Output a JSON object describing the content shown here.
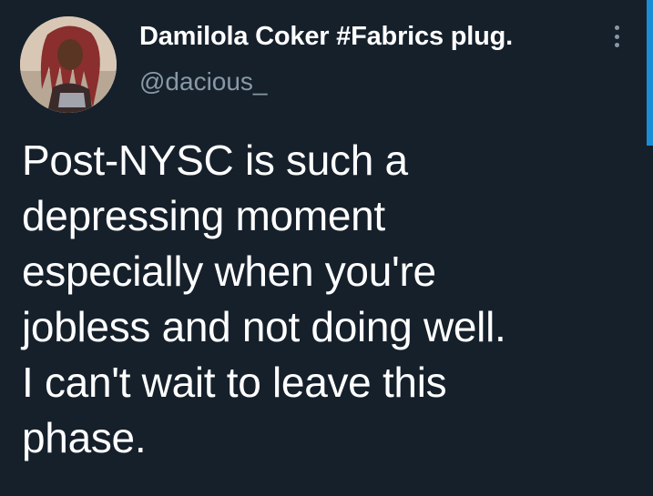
{
  "tweet": {
    "author": {
      "display_name": "Damilola Coker #Fabrics plug.",
      "handle": "@dacious_",
      "avatar_icon": "profile-photo"
    },
    "more_icon": "more-vertical-icon",
    "text": "Post-NYSC is such a\ndepressing moment\nespecially when you're\njobless and not doing well.\nI can't wait to leave this\nphase."
  },
  "theme": {
    "background": "#15202b",
    "text": "#ffffff",
    "secondary_text": "#8899a6",
    "accent": "#1da1f2"
  }
}
